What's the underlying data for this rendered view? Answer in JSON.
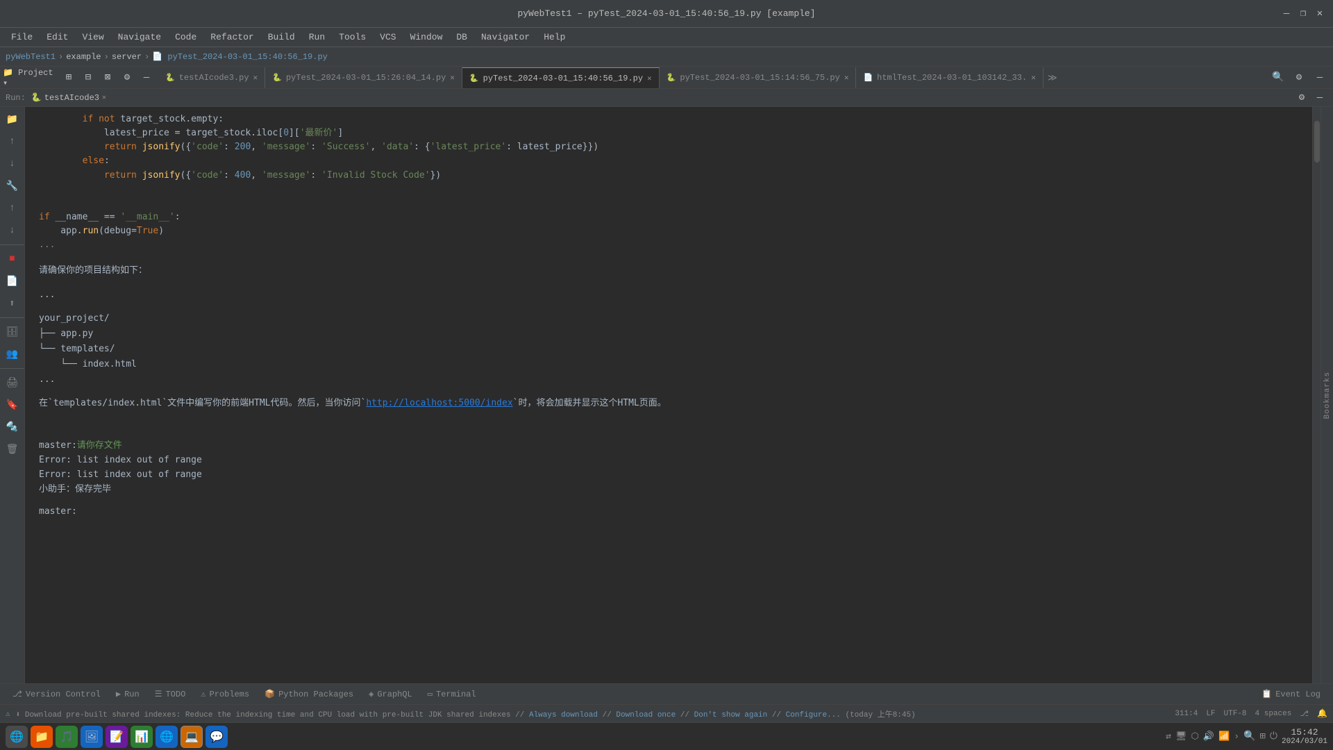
{
  "titleBar": {
    "title": "pyWebTest1 – pyTest_2024-03-01_15:40:56_19.py [example]",
    "minimize": "—",
    "restore": "❐",
    "close": "✕"
  },
  "menuBar": {
    "items": [
      "File",
      "Edit",
      "View",
      "Navigate",
      "Code",
      "Refactor",
      "Build",
      "Run",
      "Tools",
      "VCS",
      "Window",
      "DB",
      "Navigator",
      "Help"
    ]
  },
  "breadcrumb": {
    "project": "pyWebTest1",
    "sep1": "›",
    "folder": "example",
    "sep2": "›",
    "folder2": "server",
    "sep3": "›",
    "file": "pyTest_2024-03-01_15:40:56_19.py"
  },
  "tabs": [
    {
      "label": "testAIcode3.py",
      "icon": "🐍",
      "active": false,
      "closable": true
    },
    {
      "label": "pyTest_2024-03-01_15:26:04_14.py",
      "icon": "🐍",
      "active": false,
      "closable": true
    },
    {
      "label": "pyTest_2024-03-01_15:40:56_19.py",
      "icon": "🐍",
      "active": true,
      "closable": true
    },
    {
      "label": "pyTest_2024-03-01_15:14:56_75.py",
      "icon": "🐍",
      "active": false,
      "closable": true
    },
    {
      "label": "htmlTest_2024-03-01_103142_33.",
      "icon": "📄",
      "active": false,
      "closable": true
    }
  ],
  "runBar": {
    "label": "Run:",
    "tab": "testAIcode3",
    "icon": "🐍"
  },
  "codeLines": [
    "        if not target_stock.empty:",
    "            latest_price = target_stock.iloc[0]['最新价']",
    "            return jsonify({'code': 200, 'message': 'Success', 'data': {'latest_price': latest_price}})",
    "        else:",
    "            return jsonify({'code': 400, 'message': 'Invalid Stock Code'})",
    "",
    "",
    "if __name__ == '__main__':",
    "    app.run(debug=True)",
    "..."
  ],
  "aiContent": {
    "intro": "请确保你的项目结构如下：",
    "structure": "...\n\nyour_project/\n├── app.py\n└── templates/\n    └── index.html\n...",
    "desc": "在`templates/index.html`文件中编写你的前端HTML代码。然后，当你访问`",
    "link": "http://localhost:5000/index",
    "descEnd": "`时，将会加载并显示这个HTML页面。"
  },
  "terminal": {
    "prompt1": "master:",
    "greenText1": "请你存文件",
    "error1": "Error: list index out of range",
    "error2": "Error: list index out of range",
    "assistant": "小助手：保存完毕",
    "prompt2": "master:"
  },
  "bottomTabs": [
    {
      "label": "Version Control",
      "icon": "⎇",
      "active": false
    },
    {
      "label": "Run",
      "icon": "▶",
      "active": false
    },
    {
      "label": "TODO",
      "icon": "☰",
      "active": false
    },
    {
      "label": "Problems",
      "icon": "⚠",
      "active": false
    },
    {
      "label": "Python Packages",
      "icon": "📦",
      "active": false
    },
    {
      "label": "GraphQL",
      "icon": "◈",
      "active": false
    },
    {
      "label": "Terminal",
      "icon": "▭",
      "active": false
    },
    {
      "label": "Event Log",
      "icon": "📋",
      "active": false,
      "right": true
    }
  ],
  "statusBar": {
    "info": "⬇ Download pre-built shared indexes: Reduce the indexing time and CPU load with pre-built JDK shared indexes // Always download // Download once // Don't show again // Configure... (today 上午8:45)",
    "line": "311:4",
    "lf": "LF",
    "encoding": "UTF-8",
    "spaces": "4 spaces"
  },
  "taskbar": {
    "icons": [
      {
        "name": "start-icon",
        "color": "#4CAF50",
        "glyph": "🌐"
      },
      {
        "name": "files-icon",
        "color": "#FF9800",
        "glyph": "📁"
      },
      {
        "name": "music-icon",
        "color": "#4CAF50",
        "glyph": "🎵"
      },
      {
        "name": "photos-icon",
        "color": "#2196F3",
        "glyph": "🖼"
      },
      {
        "name": "notes-icon",
        "color": "#9C27B0",
        "glyph": "📝"
      },
      {
        "name": "spreadsheet-icon",
        "color": "#4CAF50",
        "glyph": "📊"
      },
      {
        "name": "browser-icon",
        "color": "#2196F3",
        "glyph": "🌐"
      },
      {
        "name": "ide-icon",
        "color": "#CC6600",
        "glyph": "💻"
      },
      {
        "name": "chat-icon",
        "color": "#1565C0",
        "glyph": "💬"
      }
    ],
    "clock": "15:42",
    "date": "2024/03/01"
  }
}
